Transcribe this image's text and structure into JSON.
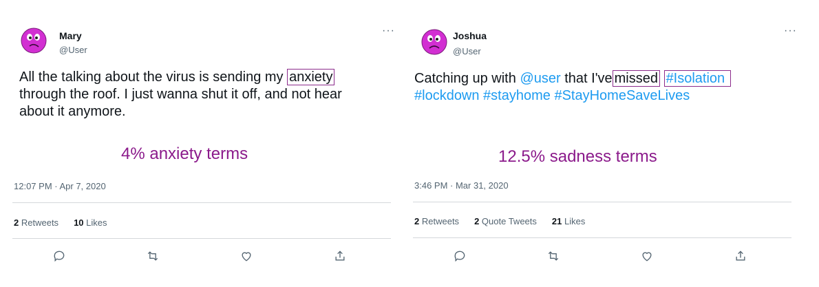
{
  "tweets": [
    {
      "name": "Mary",
      "handle": "@User",
      "more_label": "···",
      "text_before": "All the talking about the virus is sending my",
      "highlight": "anxiety",
      "text_line2": "through the roof. I just wanna shut it off, and not hear",
      "text_line3": "about it anymore.",
      "term_label": "4% anxiety terms",
      "timestamp": "12:07 PM · Apr 7, 2020",
      "retweets_count": "2",
      "retweets_label": "Retweets",
      "likes_count": "10",
      "likes_label": "Likes",
      "actions": [
        "reply-icon",
        "retweet-icon",
        "like-icon",
        "share-icon"
      ]
    },
    {
      "name": "Joshua",
      "handle": "@User",
      "more_label": "···",
      "text_before": "Catching up with",
      "mention": "@user",
      "text_mid": "that I've",
      "highlight": "missed",
      "hashtag_hl": "#Isolation",
      "line2_tags": "#lockdown #stayhome #StayHomeSaveLives",
      "term_label": "12.5% sadness terms",
      "timestamp": "3:46 PM · Mar 31, 2020",
      "retweets_count": "2",
      "retweets_label": "Retweets",
      "quotes_count": "2",
      "quotes_label": "Quote Tweets",
      "likes_count": "21",
      "likes_label": "Likes",
      "actions": [
        "reply-icon",
        "retweet-icon",
        "like-icon",
        "share-icon"
      ]
    }
  ],
  "colors": {
    "term": "#8b1a8b",
    "link": "#1d9bf0",
    "avatar": "#d22fd2"
  }
}
